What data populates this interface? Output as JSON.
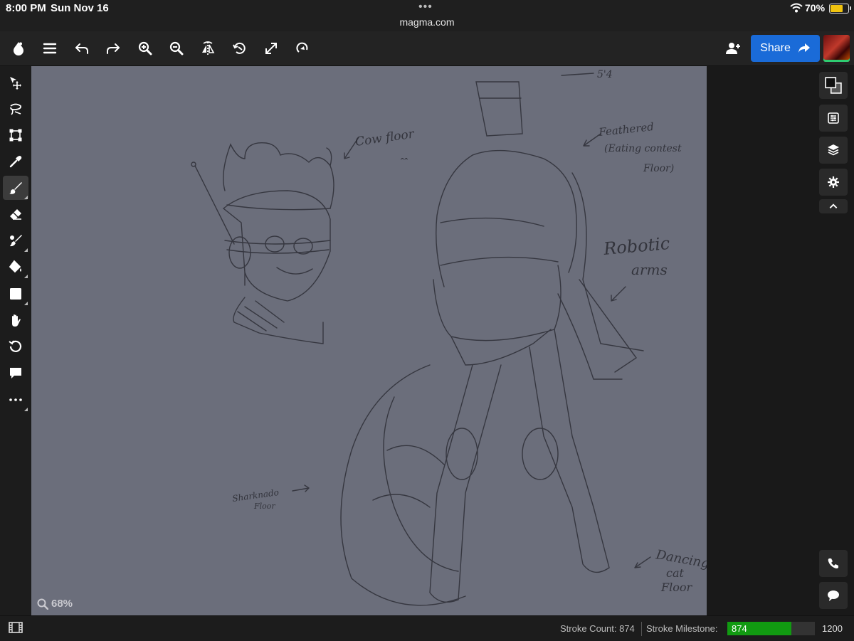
{
  "status_bar": {
    "time": "8:00 PM",
    "date": "Sun Nov 16",
    "url": "magma.com",
    "battery": "70%",
    "battery_level": 0.7,
    "dots": "•••"
  },
  "toolbar": {
    "share_label": "Share",
    "icons": [
      "magma-logo-icon",
      "menu-icon",
      "undo-icon",
      "redo-icon",
      "zoom-in-icon",
      "zoom-out-icon",
      "flip-icon",
      "rotate-icon",
      "fullscreen-icon",
      "reference-icon",
      "add-user-icon"
    ]
  },
  "tools": [
    "select-move-icon",
    "lasso-icon",
    "transform-icon",
    "eyedropper-icon",
    "brush-icon",
    "eraser-icon",
    "smudge-icon",
    "fill-icon",
    "shape-icon",
    "hand-icon",
    "rotate-view-icon",
    "comment-icon",
    "more-icon"
  ],
  "active_tool": "brush",
  "canvas": {
    "zoom": "68%",
    "annotations": {
      "height_mark": "5'4",
      "cow_floor": "Cow floor",
      "cow_floor_face": "ꞈꞈ",
      "feathered_1": "Feathered",
      "feathered_2": "(Eating contest",
      "feathered_3": "Floor)",
      "robotic_1": "Robotic",
      "robotic_2": "arms",
      "sharknado_1": "Sharknado",
      "sharknado_2": "Floor",
      "dancing_1": "Dancing",
      "dancing_2": "cat",
      "dancing_3": "Floor"
    }
  },
  "right_rail": {
    "buttons": [
      "color-swatch-icon",
      "adjustments-icon",
      "layers-icon",
      "settings-icon",
      "collapse-icon",
      "phone-icon",
      "chat-icon"
    ]
  },
  "bottom_bar": {
    "stroke_count_label": "Stroke Count: 874",
    "milestone_label": "Stroke Milestone:",
    "milestone_value": "874",
    "milestone_target": "1200",
    "milestone_progress": 0.728
  },
  "colors": {
    "canvas": "#6b6e7b",
    "share": "#1a6bd8",
    "milestone": "#119a11",
    "battery": "#f1c40f"
  }
}
